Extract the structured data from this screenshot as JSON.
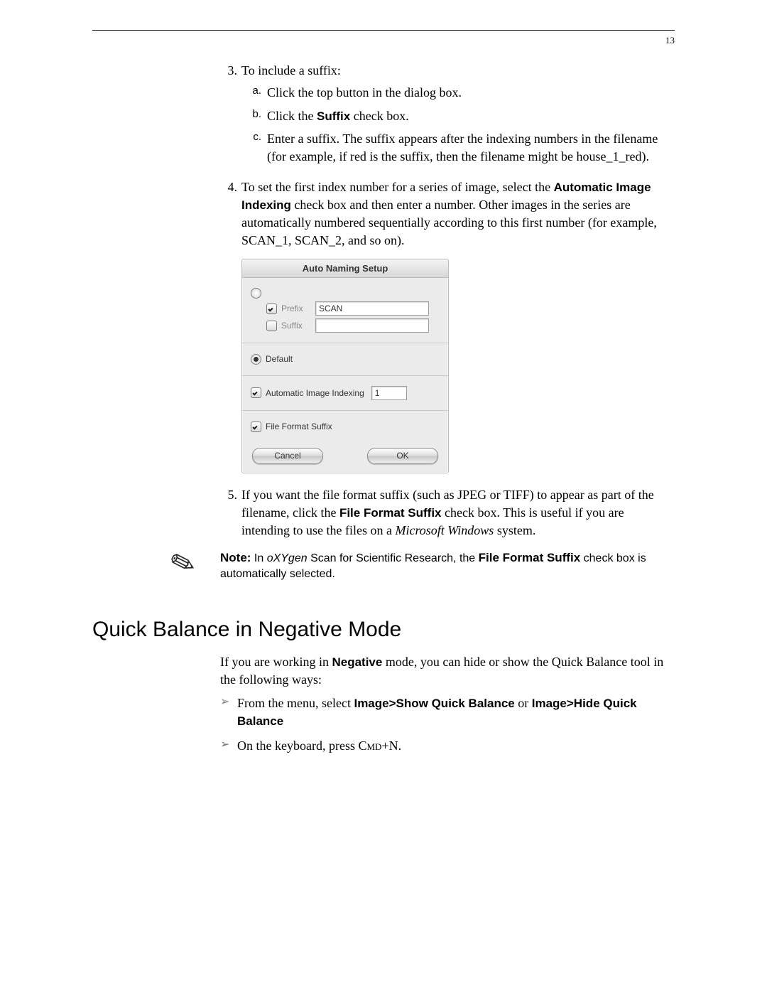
{
  "page_number": "13",
  "step3": {
    "num": "3.",
    "intro": "To include a suffix:",
    "a_mk": "a.",
    "a": "Click the top button in the dialog box.",
    "b_mk": "b.",
    "b_pre": "Click the ",
    "b_bold": "Suffix",
    "b_post": " check box.",
    "c_mk": "c.",
    "c": "Enter a suffix. The suffix appears after the indexing numbers in the filename (for example, if red is the suffix, then the filename might be house_1_red)."
  },
  "step4": {
    "num": "4.",
    "pre": "To set the first index number for a series of image, select the ",
    "bold": "Automatic Image Indexing",
    "post": " check box and then enter a number. Other images in the series are automatically numbered sequentially according to this first number (for example, SCAN_1, SCAN_2, and so on)."
  },
  "dialog": {
    "title": "Auto Naming Setup",
    "prefix_label": "Prefix",
    "prefix_value": "SCAN",
    "suffix_label": "Suffix",
    "suffix_value": "",
    "default_label": "Default",
    "auto_index_label": "Automatic Image Indexing",
    "auto_index_value": "1",
    "file_format_label": "File Format Suffix",
    "cancel": "Cancel",
    "ok": "OK"
  },
  "step5": {
    "num": "5.",
    "pre": "If you want the file format suffix (such as JPEG or TIFF) to appear as part of the filename, click the ",
    "bold": "File Format Suffix",
    "mid": " check box. This is useful if you are intending to use the files on a ",
    "italic": "Microsoft Windows",
    "post": " system."
  },
  "note": {
    "label": "Note:",
    "pre": "  In ",
    "italic": "oXYgen",
    "mid": " Scan for Scientific Research, the ",
    "bold": "File Format Suffix",
    "post": " check box is automatically selected."
  },
  "section_title": "Quick Balance in Negative Mode",
  "qb_intro_pre": "If you are working in ",
  "qb_intro_bold": "Negative",
  "qb_intro_post": " mode, you can hide or show the Quick Balance tool in the following ways:",
  "qb_items": {
    "a_mk": "➢",
    "a_pre": "From the menu, select ",
    "a_b1": "Image>Show Quick Balance",
    "a_mid": " or ",
    "a_b2": "Image>Hide Quick Balance",
    "b_mk": "➢",
    "b_pre": "On the keyboard, press ",
    "b_sc": "Cmd",
    "b_post": "+N."
  }
}
